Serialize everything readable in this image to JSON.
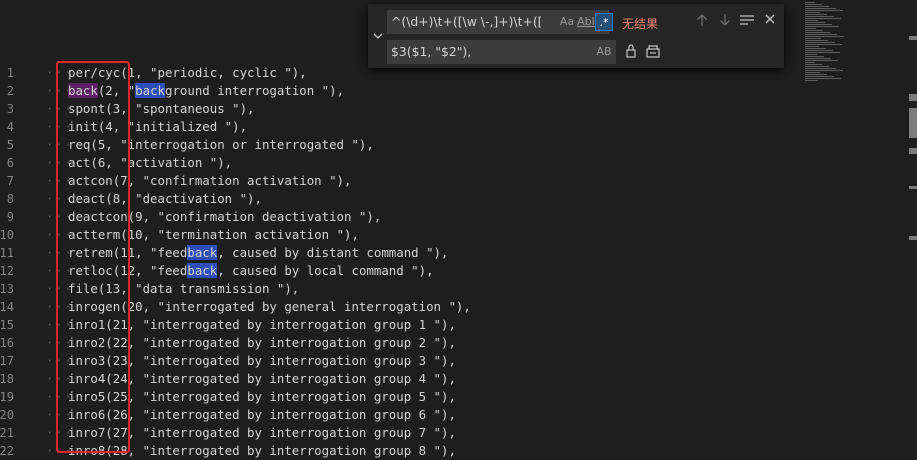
{
  "find_widget": {
    "toggle_icon": "chevron-down-icon",
    "find_value": "^(\\d+)\\t+([\\w \\-,]+)\\t+([\\w/",
    "match_case_label": "Aa",
    "whole_word_label": "AbI",
    "regex_label": ".*",
    "status_text": "无结果",
    "replace_value": "$3($1, \"$2\"),",
    "preserve_case_label": "AB",
    "icons": {
      "prev": "arrow-up-icon",
      "next": "arrow-down-icon",
      "selection": "find-in-selection-icon",
      "close": "close-icon",
      "replace": "replace-icon",
      "replace_all": "replace-all-icon"
    },
    "accent_color": "#007acc",
    "no_result_color": "#f48771"
  },
  "editor": {
    "highlight_colors": {
      "selection": "#5b1f63",
      "match": "#2e4fb8"
    },
    "annotation_color": "#e0262b",
    "lines": [
      {
        "no": "1",
        "text": "per/cyc(1, \"periodic, cyclic \"),"
      },
      {
        "no": "2",
        "segments": [
          {
            "t": "back",
            "hl": "purple"
          },
          {
            "t": "(2, \""
          },
          {
            "t": "back",
            "hl": "blue"
          },
          {
            "t": "ground interrogation \"),"
          }
        ]
      },
      {
        "no": "3",
        "text": "spont(3, \"spontaneous \"),"
      },
      {
        "no": "4",
        "text": "init(4, \"initialized \"),"
      },
      {
        "no": "5",
        "text": "req(5, \"interrogation or interrogated \"),"
      },
      {
        "no": "6",
        "text": "act(6, \"activation \"),"
      },
      {
        "no": "7",
        "text": "actcon(7, \"confirmation activation \"),"
      },
      {
        "no": "8",
        "text": "deact(8, \"deactivation \"),"
      },
      {
        "no": "9",
        "text": "deactcon(9, \"confirmation deactivation \"),"
      },
      {
        "no": "10",
        "text": "actterm(10, \"termination activation \"),"
      },
      {
        "no": "11",
        "segments": [
          {
            "t": "retrem(11, \"feed"
          },
          {
            "t": "back",
            "hl": "blue"
          },
          {
            "t": ", caused by distant command \"),"
          }
        ]
      },
      {
        "no": "12",
        "segments": [
          {
            "t": "retloc(12, \"feed"
          },
          {
            "t": "back",
            "hl": "blue"
          },
          {
            "t": ", caused by local command \"),"
          }
        ]
      },
      {
        "no": "13",
        "text": "file(13, \"data transmission \"),"
      },
      {
        "no": "14",
        "text": "inrogen(20, \"interrogated by general interrogation \"),"
      },
      {
        "no": "15",
        "text": "inro1(21, \"interrogated by interrogation group 1 \"),"
      },
      {
        "no": "16",
        "text": "inro2(22, \"interrogated by interrogation group 2 \"),"
      },
      {
        "no": "17",
        "text": "inro3(23, \"interrogated by interrogation group 3 \"),"
      },
      {
        "no": "18",
        "text": "inro4(24, \"interrogated by interrogation group 4 \"),"
      },
      {
        "no": "19",
        "text": "inro5(25, \"interrogated by interrogation group 5 \"),"
      },
      {
        "no": "20",
        "text": "inro6(26, \"interrogated by interrogation group 6 \"),"
      },
      {
        "no": "21",
        "text": "inro7(27, \"interrogated by interrogation group 7 \"),"
      },
      {
        "no": "22",
        "text": "inro8(28, \"interrogated by interrogation group 8 \"),"
      }
    ]
  }
}
